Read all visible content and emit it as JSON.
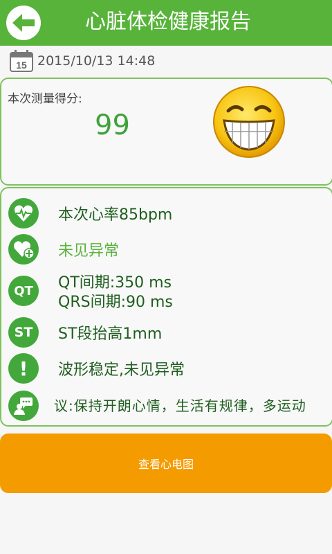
{
  "header": {
    "title": "心脏体检健康报告",
    "back_icon": "back-arrow-icon",
    "color": "#57b33a"
  },
  "report": {
    "date": "2015/10/13 14:48",
    "calendar_icon_day": "15"
  },
  "score": {
    "label": "本次测量得分:",
    "value": "99",
    "mood_icon": "grinning-face-icon"
  },
  "details": {
    "heart_rate": "本次心率85bpm",
    "status": "未见异常",
    "qt": "QT间期:350 ms",
    "qrs": "QRS间期:90 ms",
    "st_icon_label": "ST",
    "qt_icon_label": "QT",
    "st": "ST段抬高1mm",
    "waveform": "波形稳定,未见异常",
    "advice": "议:保持开朗心情，生活有规律，多运动"
  },
  "actions": {
    "view_ecg": "查看心电图",
    "color": "#f49b00"
  }
}
